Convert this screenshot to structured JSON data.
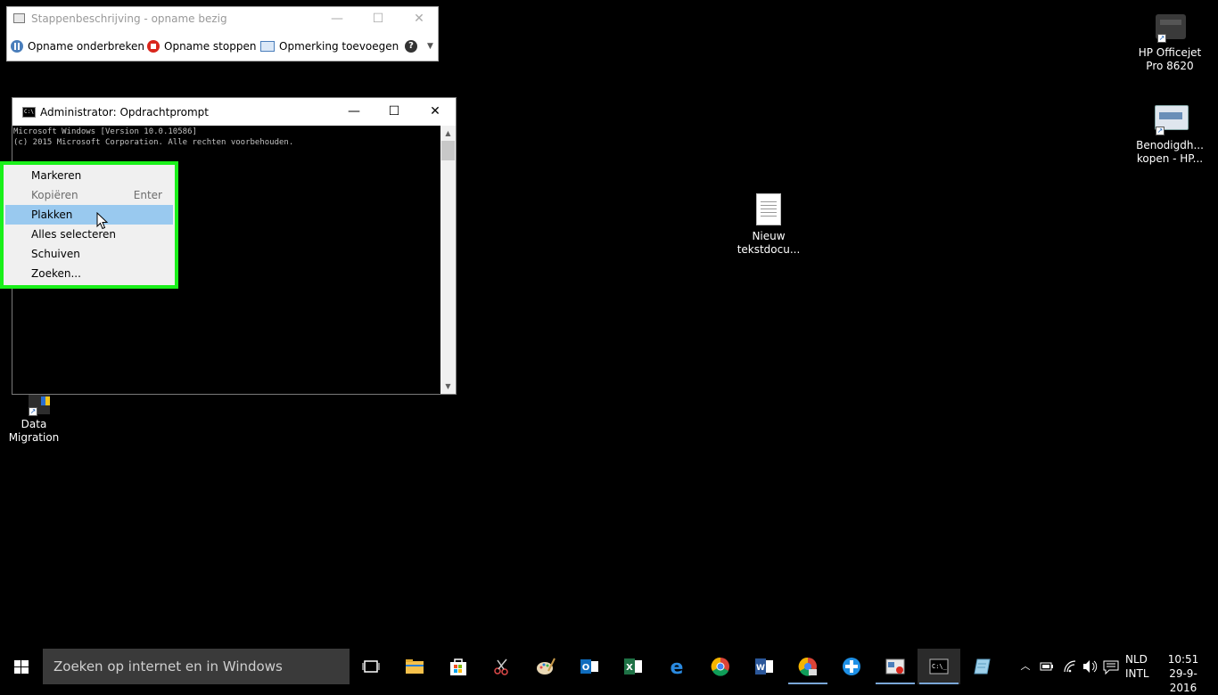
{
  "steps_recorder": {
    "title": "Stappenbeschrijving - opname bezig",
    "pause_label": "Opname onderbreken",
    "stop_label": "Opname stoppen",
    "comment_label": "Opmerking toevoegen",
    "help_icon": "?"
  },
  "cmd": {
    "title": "Administrator: Opdrachtprompt",
    "line1": "Microsoft Windows [Version 10.0.10586]",
    "line2": "(c) 2015 Microsoft Corporation. Alle rechten voorbehouden."
  },
  "context_menu": {
    "items": [
      {
        "label": "Markeren",
        "accel": ""
      },
      {
        "label": "Kopiëren",
        "accel": "Enter"
      },
      {
        "label": "Plakken",
        "accel": ""
      },
      {
        "label": "Alles selecteren",
        "accel": ""
      },
      {
        "label": "Schuiven",
        "accel": ""
      },
      {
        "label": "Zoeken...",
        "accel": ""
      }
    ]
  },
  "desktop": {
    "icons": [
      {
        "label1": "HP Officejet",
        "label2": "Pro 8620"
      },
      {
        "label1": "Benodigdh...",
        "label2": "kopen - HP..."
      },
      {
        "label1": "Nieuw",
        "label2": "tekstdocu..."
      },
      {
        "label1": "Data",
        "label2": "Migration"
      }
    ]
  },
  "taskbar": {
    "search_placeholder": "Zoeken op internet en in Windows",
    "language_line1": "NLD",
    "language_line2": "INTL",
    "time": "10:51",
    "date": "29-9-2016"
  },
  "colors": {
    "highlight_border": "#1af01a",
    "menu_highlight": "#99c9ef",
    "taskbar_accent": "#7aa7d8"
  }
}
